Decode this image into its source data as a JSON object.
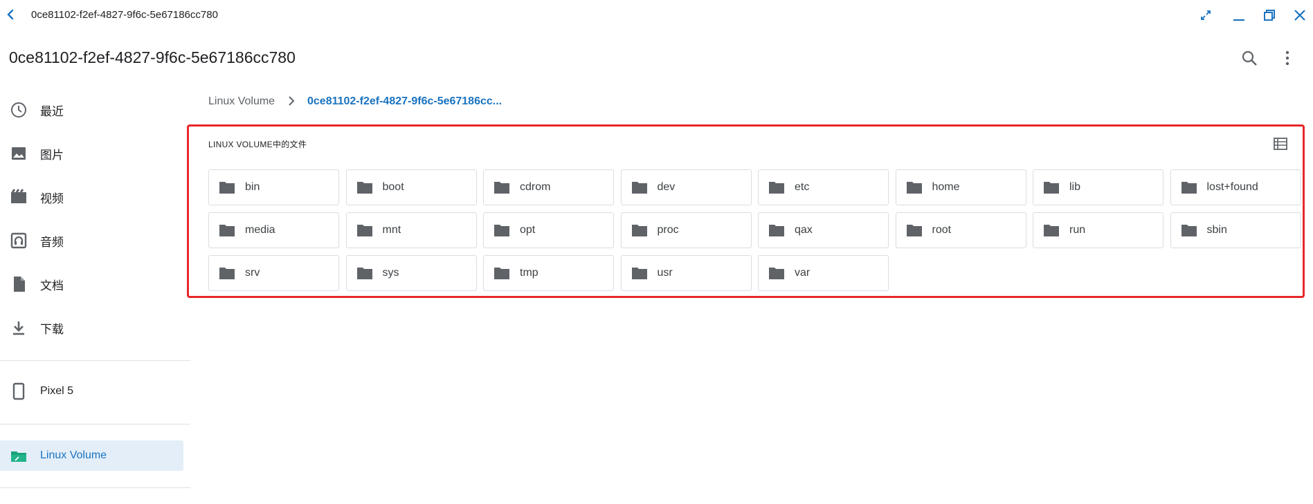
{
  "window": {
    "title": "0ce81102-f2ef-4827-9f6c-5e67186cc780"
  },
  "header": {
    "title": "0ce81102-f2ef-4827-9f6c-5e67186cc780"
  },
  "sidebar": {
    "items": [
      {
        "label": "最近",
        "icon": "clock-icon"
      },
      {
        "label": "图片",
        "icon": "image-icon"
      },
      {
        "label": "视频",
        "icon": "video-icon"
      },
      {
        "label": "音频",
        "icon": "headphones-icon"
      },
      {
        "label": "文档",
        "icon": "document-icon"
      },
      {
        "label": "下载",
        "icon": "download-icon"
      }
    ],
    "devices": [
      {
        "label": "Pixel 5",
        "icon": "phone-icon"
      }
    ],
    "volumes": [
      {
        "label": "Linux Volume",
        "icon": "linux-folder-icon",
        "active": true
      }
    ]
  },
  "breadcrumb": {
    "root": "Linux Volume",
    "current": "0ce81102-f2ef-4827-9f6c-5e67186cc..."
  },
  "section": {
    "label": "LINUX VOLUME中的文件"
  },
  "folders": [
    "bin",
    "boot",
    "cdrom",
    "dev",
    "etc",
    "home",
    "lib",
    "lost+found",
    "media",
    "mnt",
    "opt",
    "proc",
    "qax",
    "root",
    "run",
    "sbin",
    "srv",
    "sys",
    "tmp",
    "usr",
    "var"
  ],
  "colors": {
    "accent": "#1a73c0",
    "active_bg": "#e3eef8",
    "highlight": "#e8262a",
    "folder": "#5f6368"
  }
}
